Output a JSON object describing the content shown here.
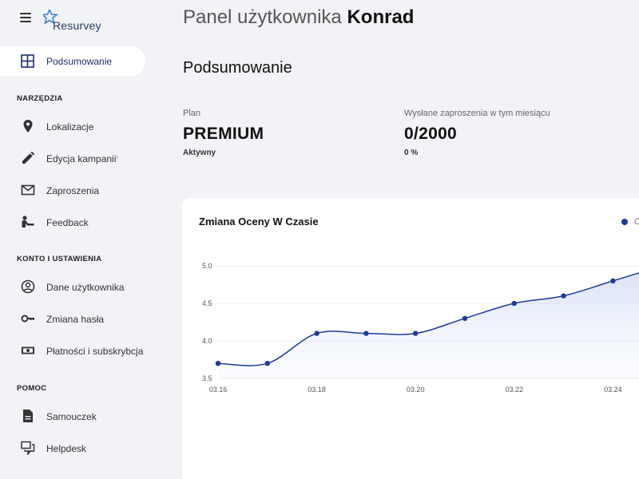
{
  "app": {
    "logo_text": "Resurvey"
  },
  "header": {
    "title_prefix": "Panel użytkownika",
    "user_name": "Konrad"
  },
  "sidebar": {
    "active_item": {
      "label": "Podsumowanie",
      "icon": "dashboard-grid-icon"
    },
    "sections": [
      {
        "title": "NARZĘDZIA",
        "items": [
          {
            "label": "Lokalizacje",
            "icon": "location-pin-icon"
          },
          {
            "label": "Edycja kampanii",
            "icon": "pencil-icon",
            "chevron": "›"
          },
          {
            "label": "Zaproszenia",
            "icon": "envelope-icon"
          },
          {
            "label": "Feedback",
            "icon": "feedback-person-icon"
          }
        ]
      },
      {
        "title": "KONTO I USTAWIENIA",
        "items": [
          {
            "label": "Dane użytkownika",
            "icon": "user-circle-icon"
          },
          {
            "label": "Zmiana hasła",
            "icon": "key-icon"
          },
          {
            "label": "Płatności i subskrybcja",
            "icon": "money-icon"
          }
        ]
      },
      {
        "title": "POMOC",
        "items": [
          {
            "label": "Samouczek",
            "icon": "document-icon"
          },
          {
            "label": "Helpdesk",
            "icon": "chat-bubbles-icon"
          }
        ]
      }
    ]
  },
  "main": {
    "section_title": "Podsumowanie",
    "stats": {
      "plan": {
        "label": "Plan",
        "value": "PREMIUM",
        "sub": "Aktywny"
      },
      "invites": {
        "label": "Wysłane zaproszenia w tym miesiącu",
        "value": "0/2000",
        "sub": "0 %"
      }
    }
  },
  "chart_card": {
    "title": "Zmiana Oceny W Czasie",
    "legend_label": "O"
  },
  "colors": {
    "accent": "#1f3a9c",
    "sidebar_active_text": "#1c2e6e"
  },
  "chart_data": {
    "type": "area",
    "title": "Zmiana Oceny W Czasie",
    "x": [
      "03.16",
      "03.17",
      "03.18",
      "03.19",
      "03.20",
      "03.21",
      "03.22",
      "03.23",
      "03.24",
      "03.25"
    ],
    "x_tick_labels": [
      "03.16",
      "03.18",
      "03.20",
      "03.22",
      "03.24"
    ],
    "series": [
      {
        "values": [
          3.7,
          3.7,
          4.1,
          4.1,
          4.1,
          4.3,
          4.5,
          4.6,
          4.8,
          5.0
        ]
      }
    ],
    "y_ticks": [
      3.5,
      4.0,
      4.5,
      5.0
    ],
    "ylim": [
      3.5,
      5.0
    ],
    "grid": true,
    "legend_position": "top-right"
  }
}
